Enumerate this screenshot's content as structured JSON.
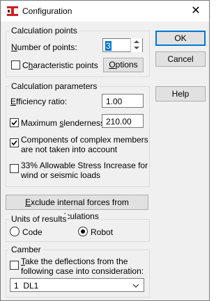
{
  "window": {
    "title": "Configuration",
    "close_glyph": "✕"
  },
  "calc_points": {
    "legend": "Calculation points",
    "num_points_label_u": "N",
    "num_points_label_rest": "umber of points:",
    "num_points_value": "3",
    "characteristic_label_pre": "C",
    "characteristic_label_u": "h",
    "characteristic_label_rest": "aracteristic points",
    "characteristic_checked": false,
    "options_label_u": "O",
    "options_label_rest": "ptions"
  },
  "calc_params": {
    "legend": "Calculation parameters",
    "efficiency_label_u": "E",
    "efficiency_label_rest": "fficiency ratio:",
    "efficiency_value": "1.00",
    "max_slender_label_pre": "Maximum ",
    "max_slender_label_u": "s",
    "max_slender_label_rest": "lenderness:",
    "max_slender_checked": true,
    "max_slender_value": "210.00",
    "components_line1": "Components of complex members",
    "components_line2": "are not taken into account",
    "components_checked": true,
    "stress_line1": "33% Allowable Stress Increase for",
    "stress_line2": "wind or seismic loads",
    "stress_checked": false
  },
  "exclude_button_label_u": "E",
  "exclude_button_label_rest": "xclude internal forces from calculations",
  "units": {
    "legend": "Units of results",
    "code_label": "Code",
    "robot_label": "Robot",
    "selected": "Robot"
  },
  "camber": {
    "legend": "Camber",
    "take_line1_u": "T",
    "take_line1_rest": "ake the deflections from the",
    "take_line2": "following case into consideration:",
    "take_checked": false,
    "case_selected": "1  DL1"
  },
  "buttons": {
    "ok": "OK",
    "cancel": "Cancel",
    "help": "Help"
  },
  "colors": {
    "accent": "#0078d7",
    "icon_red": "#d11f1f"
  }
}
